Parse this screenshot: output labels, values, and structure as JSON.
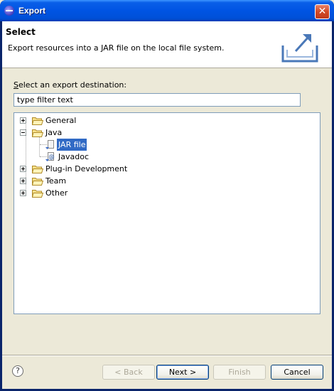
{
  "window": {
    "title": "Export",
    "close_glyph": "✕"
  },
  "header": {
    "title": "Select",
    "description": "Export resources into a JAR file on the local file system."
  },
  "destination": {
    "label_prefix": "S",
    "label_rest": "elect an export destination:",
    "filter_value": "type filter text"
  },
  "tree": [
    {
      "label": "General",
      "expanded": false
    },
    {
      "label": "Java",
      "expanded": true,
      "children": [
        {
          "label": "JAR file",
          "selected": true
        },
        {
          "label": "Javadoc",
          "selected": false
        }
      ]
    },
    {
      "label": "Plug-in Development",
      "expanded": false
    },
    {
      "label": "Team",
      "expanded": false
    },
    {
      "label": "Other",
      "expanded": false
    }
  ],
  "buttons": {
    "help_glyph": "?",
    "back": "< Back",
    "next": "Next >",
    "finish": "Finish",
    "cancel": "Cancel"
  },
  "colors": {
    "selection": "#316ac5",
    "titlebar": "#0054e3",
    "dialog_bg": "#ece9d8"
  }
}
